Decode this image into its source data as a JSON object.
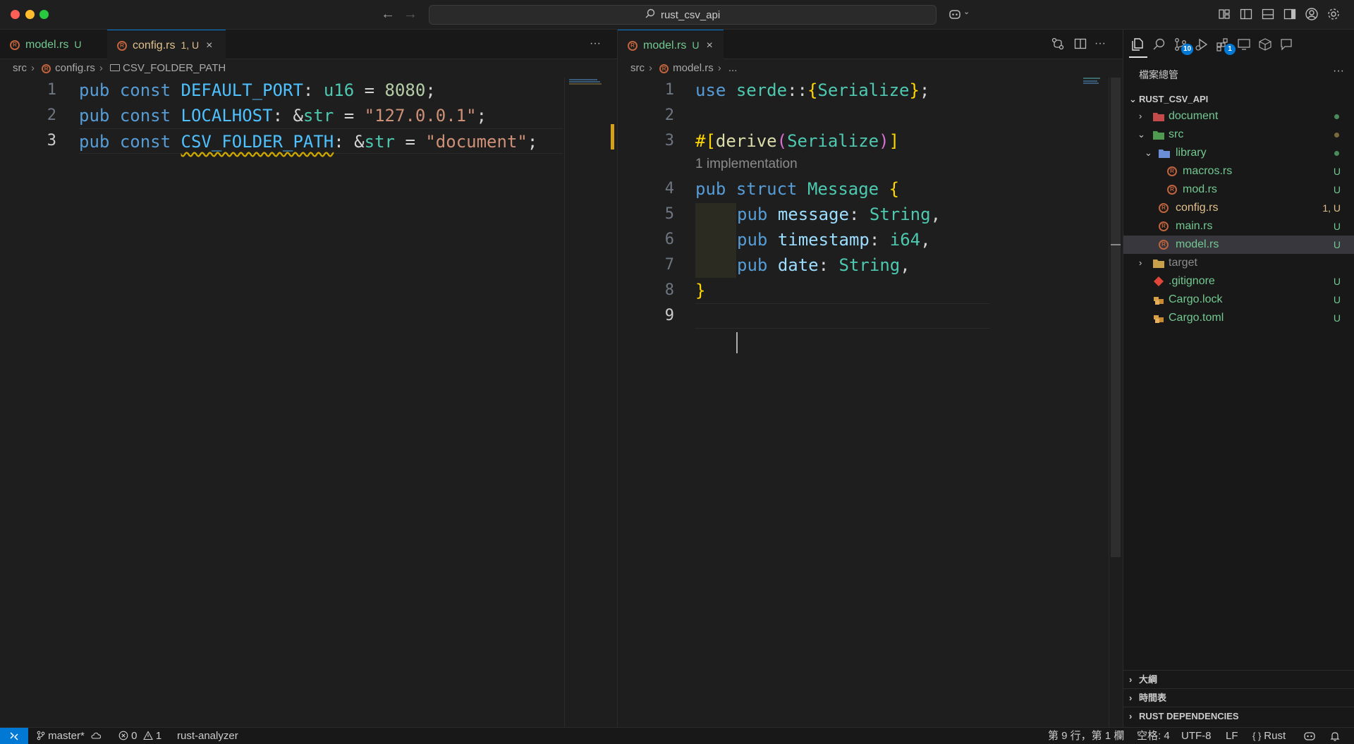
{
  "titlebar": {
    "search_text": "rust_csv_api"
  },
  "left_editor": {
    "tabs": [
      {
        "name": "model.rs",
        "status": "U"
      },
      {
        "name": "config.rs",
        "status": "1, U"
      }
    ],
    "close_glyph": "×",
    "more_glyph": "···",
    "breadcrumb": {
      "folder": "src",
      "file": "config.rs",
      "symbol": "CSV_FOLDER_PATH"
    },
    "line_numbers": [
      "1",
      "2",
      "3"
    ],
    "code": {
      "l1": {
        "kw1": "pub",
        "kw2": "const",
        "name": "DEFAULT_PORT",
        "colon": ":",
        "type": "u16",
        "eq": "=",
        "val": "8080",
        "semi": ";"
      },
      "l2": {
        "kw1": "pub",
        "kw2": "const",
        "name": "LOCALHOST",
        "colon": ":",
        "amp": "&",
        "type": "str",
        "eq": "=",
        "val": "\"127.0.0.1\"",
        "semi": ";"
      },
      "l3": {
        "kw1": "pub",
        "kw2": "const",
        "name": "CSV_FOLDER_PATH",
        "colon": ":",
        "amp": "&",
        "type": "str",
        "eq": "=",
        "val": "\"document\"",
        "semi": ";"
      }
    }
  },
  "right_editor": {
    "tab": {
      "name": "model.rs",
      "status": "U"
    },
    "close_glyph": "×",
    "more_glyph": "···",
    "breadcrumb": {
      "folder": "src",
      "file": "model.rs",
      "ellipsis": "..."
    },
    "line_numbers": [
      "1",
      "2",
      "3",
      "4",
      "5",
      "6",
      "7",
      "8",
      "9"
    ],
    "code": {
      "l1": {
        "kw": "use",
        "crate": "serde",
        "sep": "::",
        "open": "{",
        "item": "Serialize",
        "close": "}",
        "semi": ";"
      },
      "l3": {
        "hash": "#",
        "open": "[",
        "fn": "derive",
        "popen": "(",
        "item": "Serialize",
        "pclose": ")",
        "close": "]"
      },
      "codelens": "1 implementation",
      "l4": {
        "kw1": "pub",
        "kw2": "struct",
        "name": "Message",
        "open": "{"
      },
      "l5": {
        "kw": "pub",
        "field": "message",
        "colon": ":",
        "type": "String",
        "comma": ","
      },
      "l6": {
        "kw": "pub",
        "field": "timestamp",
        "colon": ":",
        "type": "i64",
        "comma": ","
      },
      "l7": {
        "kw": "pub",
        "field": "date",
        "colon": ":",
        "type": "String",
        "comma": ","
      },
      "l8": {
        "close": "}"
      }
    }
  },
  "sidebar": {
    "title": "檔案總管",
    "more_glyph": "···",
    "badges": {
      "source_control": "10",
      "extensions": "1"
    },
    "root": "RUST_CSV_API",
    "tree": [
      {
        "label": "document",
        "status": ""
      },
      {
        "label": "src",
        "status": ""
      },
      {
        "label": "library",
        "status": ""
      },
      {
        "label": "macros.rs",
        "status": "U"
      },
      {
        "label": "mod.rs",
        "status": "U"
      },
      {
        "label": "config.rs",
        "status": "1, U"
      },
      {
        "label": "main.rs",
        "status": "U"
      },
      {
        "label": "model.rs",
        "status": "U"
      },
      {
        "label": "target",
        "status": ""
      },
      {
        "label": ".gitignore",
        "status": "U"
      },
      {
        "label": "Cargo.lock",
        "status": "U"
      },
      {
        "label": "Cargo.toml",
        "status": "U"
      }
    ],
    "sections": [
      "大綱",
      "時間表",
      "RUST DEPENDENCIES"
    ]
  },
  "statusbar": {
    "branch": "master*",
    "errors": "0",
    "warnings": "1",
    "analyzer": "rust-analyzer",
    "position": "第 9 行，第 1 欄",
    "spaces": "空格: 4",
    "encoding": "UTF-8",
    "eol": "LF",
    "language": "Rust"
  },
  "colors": {
    "accent": "#0078d4",
    "untracked": "#73c991",
    "modified": "#e2c08d"
  }
}
